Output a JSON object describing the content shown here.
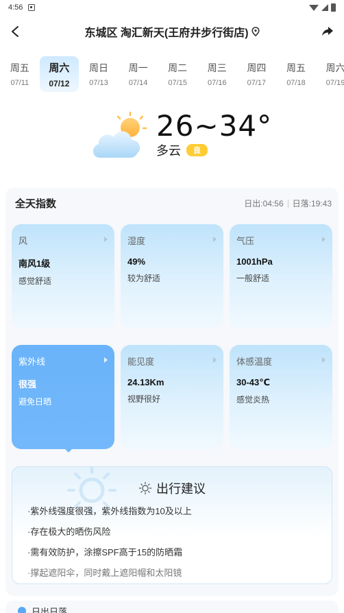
{
  "status_bar": {
    "time": "4:56"
  },
  "nav": {
    "title": "东城区 淘汇新天(王府井步行街店)"
  },
  "days": [
    {
      "name": "周五",
      "date": "07/11",
      "active": false
    },
    {
      "name": "周六",
      "date": "07/12",
      "active": true
    },
    {
      "name": "周日",
      "date": "07/13",
      "active": false
    },
    {
      "name": "周一",
      "date": "07/14",
      "active": false
    },
    {
      "name": "周二",
      "date": "07/15",
      "active": false
    },
    {
      "name": "周三",
      "date": "07/16",
      "active": false
    },
    {
      "name": "周四",
      "date": "07/17",
      "active": false
    },
    {
      "name": "周五",
      "date": "07/18",
      "active": false
    },
    {
      "name": "周六",
      "date": "07/19",
      "active": false
    }
  ],
  "summary": {
    "temperature": "26~34°",
    "condition": "多云",
    "aqi": "良",
    "icon": "partly-cloudy-icon"
  },
  "panel": {
    "title": "全天指数",
    "sunrise": "日出:04:56",
    "sunset": "日落:19:43"
  },
  "indices": [
    {
      "label": "风",
      "value": "南风1级",
      "desc": "感觉舒适"
    },
    {
      "label": "湿度",
      "value": "49%",
      "desc": "较为舒适"
    },
    {
      "label": "气压",
      "value": "1001hPa",
      "desc": "一般舒适"
    },
    {
      "label": "紫外线",
      "value": "很强",
      "desc": "避免日晒"
    },
    {
      "label": "能见度",
      "value": "24.13Km",
      "desc": "视野很好"
    },
    {
      "label": "体感温度",
      "value": "30-43℃",
      "desc": "感觉炎热"
    }
  ],
  "advice": {
    "title": "出行建议",
    "items": [
      "·紫外线强度很强，紫外线指数为10及以上",
      "·存在极大的晒伤风险",
      "·需有效防护，涂擦SPF高于15的防晒霜",
      "·撑起遮阳伞，同时戴上遮阳帽和太阳镜"
    ]
  },
  "bottom": {
    "peek_text": "日出日落"
  },
  "colors": {
    "accent": "#6ab3fa",
    "aqi": "#ffcc33"
  }
}
